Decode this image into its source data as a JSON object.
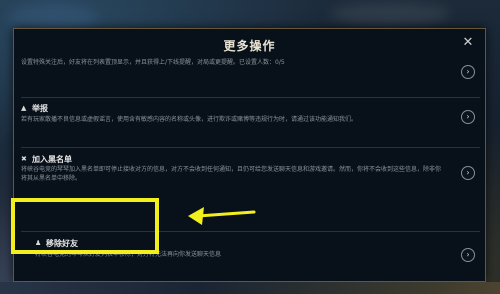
{
  "dialog": {
    "title": "更多操作",
    "close_label": "✕"
  },
  "items": [
    {
      "title": "",
      "description": "设置特殊关注后，好友将在列表置顶显示，并且获得上/下线提醒，对局或更提醒。已设置人数：0/5",
      "icon": "",
      "arrow": "›"
    },
    {
      "title": "举报",
      "description": "若有玩家散播不良信息或虚假谣言，使用含有敏感内容的名称或头像，进行欺诈或赌博等违规行为时，请通过该功能通知我们。",
      "icon": "warning-icon",
      "glyph": "▲",
      "arrow": "›"
    },
    {
      "title": "加入黑名单",
      "description": "将峡谷电竞的琴琴加入黑名单即可停止接收对方的信息，对方不会收到任何通知，且仍可给您发送聊天信息和游戏邀请。然而，你将不会收到这些信息，除非你将其从黑名单中移除。",
      "icon": "block-user-icon",
      "glyph": "✖",
      "arrow": "›"
    },
    {
      "title": "移除好友",
      "description": "将峡谷电竞的琴琴从好友列表中移除，对方将无法再向你发送聊天信息",
      "icon": "remove-user-icon",
      "glyph": "♟",
      "arrow": "›"
    }
  ],
  "annotation": {
    "highlight_color": "#f2ef1c",
    "pointer_icon": "left-arrow-pointer"
  }
}
